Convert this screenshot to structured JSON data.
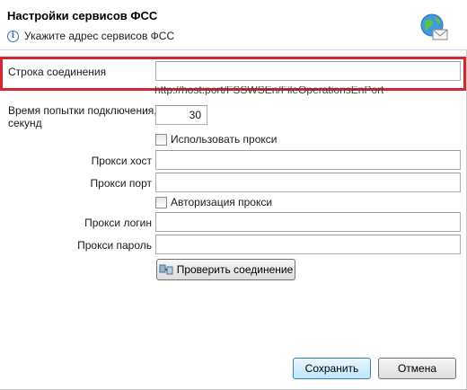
{
  "dialog": {
    "title": "Настройки сервисов ФСС",
    "subtitle": "Укажите адрес сервисов ФСС",
    "header_icon": "globe-mail-icon",
    "info_icon": "info-icon"
  },
  "form": {
    "connection_string": {
      "label": "Строка соединения",
      "value": "",
      "hint": "http://host:port/FSSWSEn/FileOperationsEnPort"
    },
    "timeout": {
      "label_line1": "Время попытки подключения,",
      "label_line2": "секунд",
      "value": "30"
    },
    "use_proxy": {
      "label": "Использовать прокси",
      "checked": false
    },
    "proxy_host": {
      "label": "Прокси хост",
      "value": ""
    },
    "proxy_port": {
      "label": "Прокси порт",
      "value": ""
    },
    "proxy_auth": {
      "label": "Авторизация прокси",
      "checked": false
    },
    "proxy_login": {
      "label": "Прокси логин",
      "value": ""
    },
    "proxy_password": {
      "label": "Прокси пароль",
      "value": ""
    },
    "test_button": {
      "label": "Проверить соединение",
      "icon": "connection-check-icon"
    }
  },
  "footer": {
    "save_label": "Сохранить",
    "cancel_label": "Отмена"
  },
  "colors": {
    "highlight": "#d9252f",
    "primary_button_border": "#3c7fb1",
    "info": "#3a6fb5"
  }
}
